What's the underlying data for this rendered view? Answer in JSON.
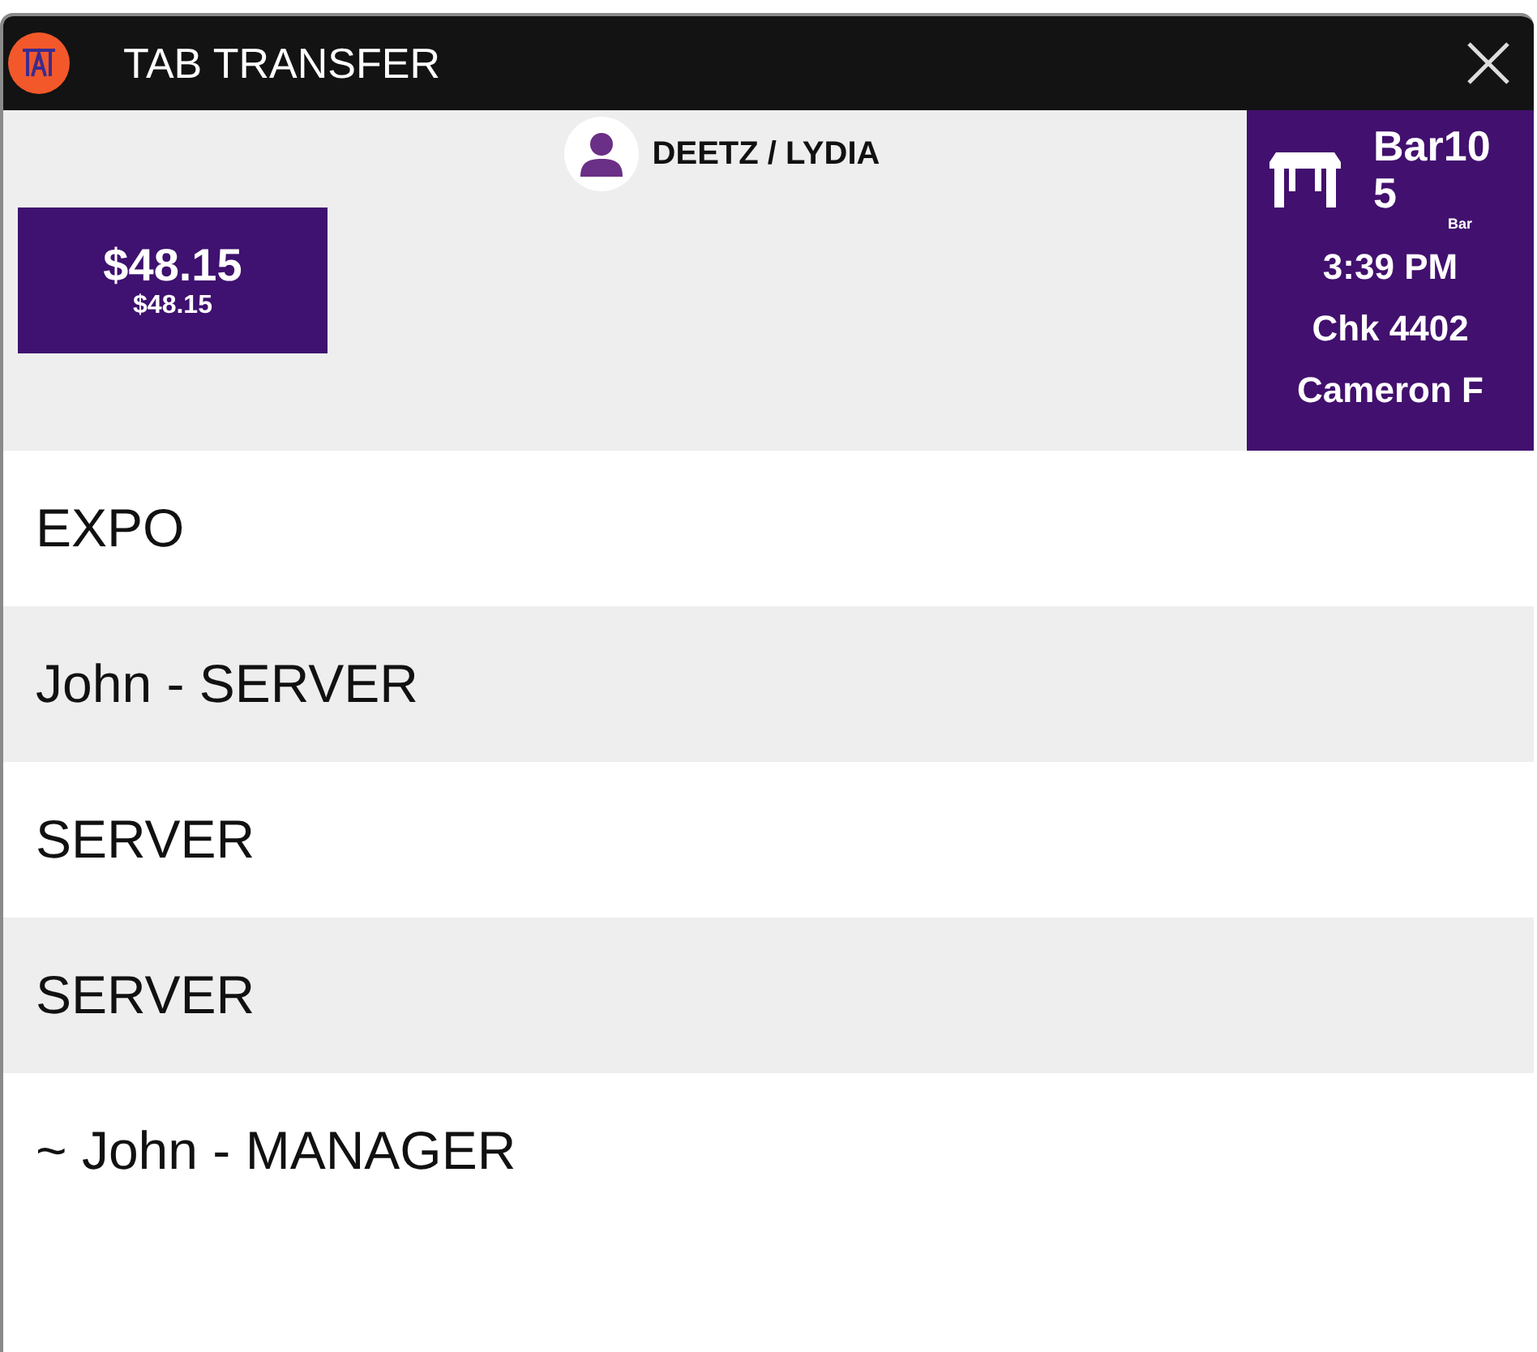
{
  "window": {
    "title": "TAB TRANSFER"
  },
  "customer": {
    "name": "DEETZ / LYDIA"
  },
  "total": {
    "amount": "$48.15",
    "subtotal": "$48.15"
  },
  "check": {
    "table": "Bar10\n5",
    "area": "Bar",
    "time": "3:39 PM",
    "check_number": "Chk 4402",
    "server": "Cameron F"
  },
  "employees": [
    {
      "name": "EXPO"
    },
    {
      "name": "John - SERVER"
    },
    {
      "name": "SERVER"
    },
    {
      "name": "SERVER"
    },
    {
      "name": "~ John - MANAGER"
    }
  ]
}
